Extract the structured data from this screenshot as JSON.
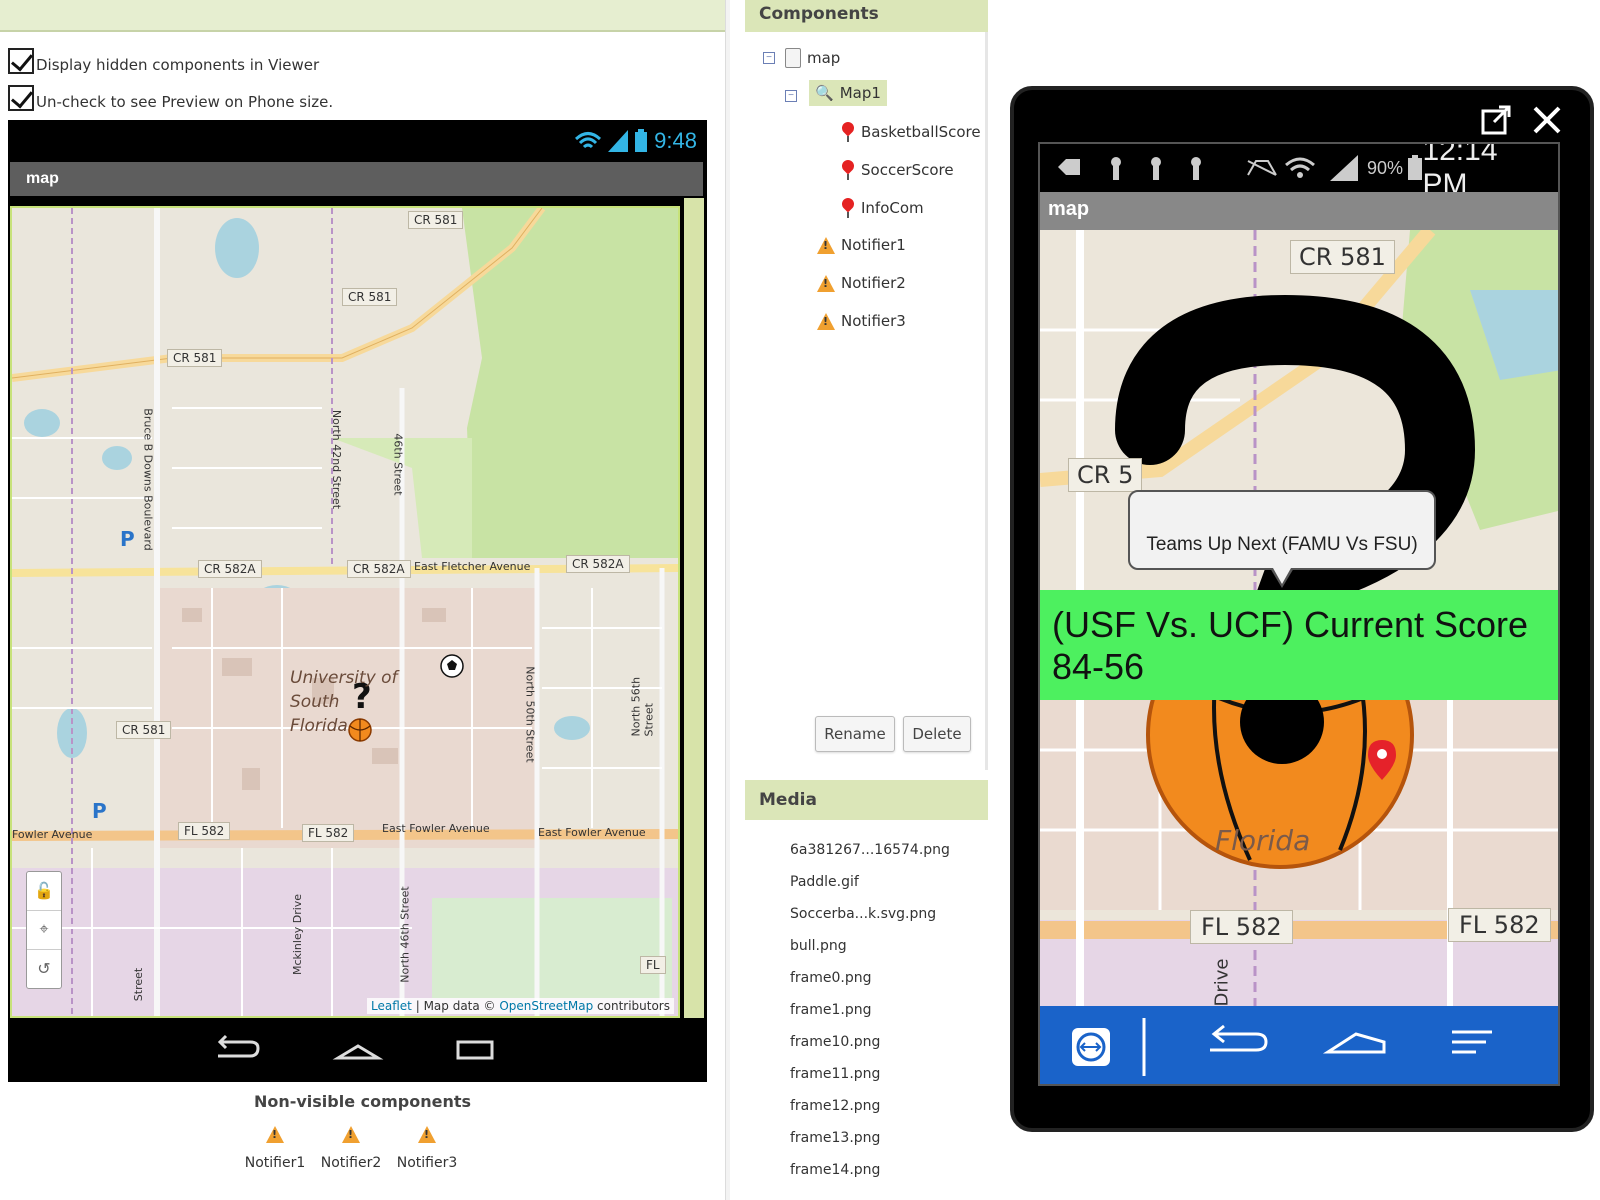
{
  "viewer": {
    "checkbox_hidden_label": "Display hidden components in Viewer",
    "checkbox_preview_label": "Un-check to see Preview on Phone size.",
    "phone_status_time": "9:48",
    "phone_title": "map",
    "road_labels": {
      "cr581_a": "CR 581",
      "cr581_b": "CR 581",
      "cr581_c": "CR 581",
      "cr581_d": "CR 581",
      "cr582a_a": "CR 582A",
      "cr582a_b": "CR 582A",
      "cr582a_c": "CR 582A",
      "fl582_a": "FL 582",
      "fl582_b": "FL 582",
      "fl_c": "FL"
    },
    "street_labels": {
      "east_fletcher": "East Fletcher Avenue",
      "fowler": "Fowler Avenue",
      "east_fowler_a": "East Fowler Avenue",
      "east_fowler_b": "East Fowler Avenue",
      "north_56th": "North 56th Street",
      "north_50th": "North 50th Street",
      "north_42nd": "North 42nd Street",
      "forty_sixth": "46th Street",
      "north_46th": "North 46th Street",
      "mckinley": "Mckinley Drive",
      "bruce_b_downs": "Bruce B Downs Boulevard",
      "street": "Street",
      "university": "University of South Florida"
    },
    "attribution": {
      "leaflet": "Leaflet",
      "sep": " | Map data © ",
      "osm": "OpenStreetMap",
      "contrib": " contributors"
    },
    "nonvisible_title": "Non-visible components",
    "nonvisible_items": [
      "Notifier1",
      "Notifier2",
      "Notifier3"
    ]
  },
  "components": {
    "header": "Components",
    "tree": {
      "root": "map",
      "map1": "Map1",
      "children": [
        "BasketballScore",
        "SoccerScore",
        "InfoCom"
      ],
      "notifiers": [
        "Notifier1",
        "Notifier2",
        "Notifier3"
      ]
    },
    "rename_label": "Rename",
    "delete_label": "Delete"
  },
  "media": {
    "header": "Media",
    "files": [
      "6a381267...16574.png",
      "Paddle.gif",
      "Soccerba...k.svg.png",
      "bull.png",
      "frame0.png",
      "frame1.png",
      "frame10.png",
      "frame11.png",
      "frame12.png",
      "frame13.png",
      "frame14.png"
    ]
  },
  "device": {
    "battery": "90%",
    "clock": "12:14 PM",
    "title": "map",
    "map_labels": {
      "cr581": "CR 581",
      "cr5": "CR 5",
      "fl582_a": "FL 582",
      "fl582_b": "FL 582",
      "florida": "Florida",
      "drive": "Drive"
    },
    "tooltip": "Teams Up Next (FAMU Vs FSU)",
    "score_line1": "(USF Vs. UCF) Current Score",
    "score_line2": "84-56"
  },
  "colors": {
    "accent_green": "#dbe6b8",
    "score_banner": "#4df05f",
    "navbar_blue": "#1a63c9",
    "status_blue": "#33b5e5"
  }
}
